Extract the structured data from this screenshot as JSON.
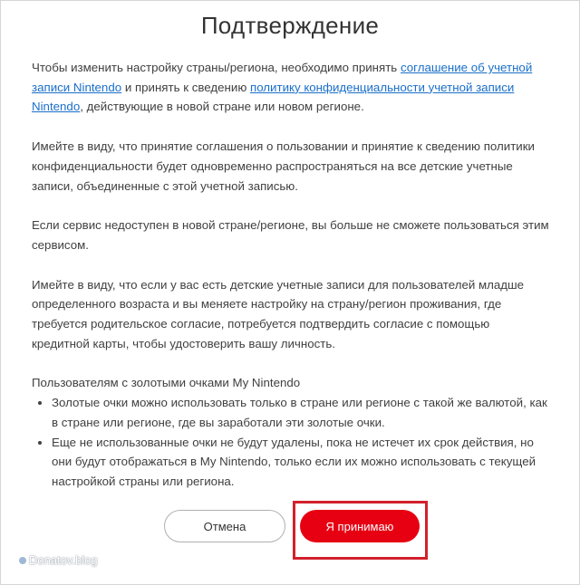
{
  "dialog": {
    "title": "Подтверждение",
    "p1": {
      "t1": "Чтобы изменить настройку страны/региона, необходимо принять ",
      "link1": "соглашение об учетной записи Nintendo",
      "t2": " и принять к сведению ",
      "link2": "политику конфиденциальности учетной записи Nintendo",
      "t3": ", действующие в новой стране или новом регионе."
    },
    "p2": "Имейте в виду, что принятие соглашения о пользовании и принятие к сведению политики конфиденциальности будет одновременно распространяться на все детские учетные записи, объединенные с этой учетной записью.",
    "p3": "Если сервис недоступен в новой стране/регионе, вы больше не сможете пользоваться этим сервисом.",
    "p4": "Имейте в виду, что если у вас есть детские учетные записи для пользователей младше определенного возраста и вы меняете настройку на страну/регион проживания, где требуется родительское согласие, потребуется подтвердить согласие с помощью кредитной карты, чтобы удостоверить вашу личность.",
    "gold_points": {
      "heading": "Пользователям с золотыми очками My Nintendo",
      "items": [
        "Золотые очки можно использовать только в стране или регионе с такой же валютой, как в стране или регионе, где вы заработали эти золотые очки.",
        "Еще не использованные очки не будут удалены, пока не истечет их срок действия, но они будут отображаться в My Nintendo, только если их можно использовать с текущей настройкой страны или региона."
      ]
    },
    "buttons": {
      "cancel": "Отмена",
      "accept": "Я принимаю"
    },
    "colors": {
      "accept_bg": "#e60012",
      "link": "#1a6fc9",
      "highlight_box": "#d3202c"
    }
  },
  "watermark": "Donatov.blog"
}
